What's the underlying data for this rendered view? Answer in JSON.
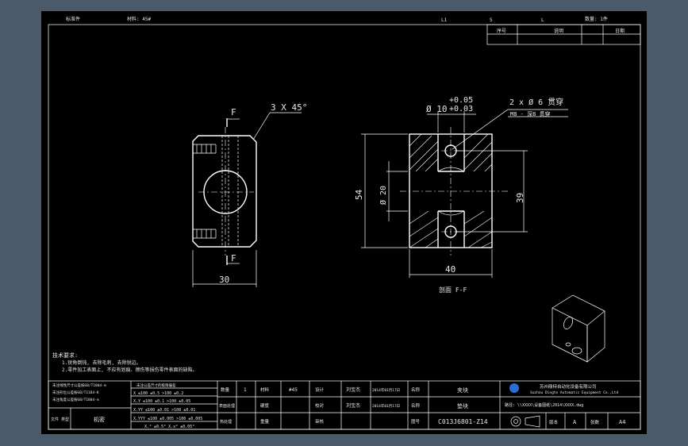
{
  "top_strip": {
    "left_1": "标准件",
    "left_2": "材料: 45#",
    "mark_l1": "L1",
    "mark_s": "S",
    "mark_l": "L",
    "mark_qty": "数量: 1件"
  },
  "rev_table": {
    "c1": "序号",
    "c2": "说明",
    "c3": "日期"
  },
  "front_view": {
    "label_f_top": "F",
    "label_f_bottom": "F",
    "chamfer": "3 X 45°",
    "width": "30"
  },
  "section_view": {
    "tol_upper": "+0.05",
    "tol_lower": "+0.03",
    "bore_dia": "Ø 10",
    "hole_note": "2 x Ø 6 贯穿",
    "hole_note2": "M8 - 深8 贯穿",
    "height": "54",
    "dia20": "Ø 20",
    "dim39": "39",
    "width": "40",
    "caption": "剖面 F-F"
  },
  "tech_notes": {
    "title": "技术要求:",
    "line1": "1.锐角倒钝, 去除毛刺, 去除锐边。",
    "line2": "2.零件加工表面上, 不应有划痕、擦伤等损伤零件表面的缺陷。"
  },
  "tolerance_table": {
    "head_left1": "未注线性尺寸公差按GB/T1804-m",
    "head_left2": "未注形位公差按GB/T1184-K",
    "head_left3": "未注角度公差按GB/T1804-m",
    "head_right": "未注公差尺寸的极限偏差",
    "rows": [
      "X      ≤100  ±0.5  >100  ±0.2",
      "X.Y    ≤100  ±0.1  >100  ±0.05",
      "X.YY   ≤100  ±0.01  >100  ±0.01",
      "X.YYY  ≤100  ±0.005  >100  ±0.005",
      "X.°  ±0.5°     X.x°  ±0.05°"
    ],
    "bottom_left": "机密",
    "bottom_left2": "文件\n类型"
  },
  "title_block": {
    "r1": [
      "数量",
      "1",
      "材料",
      "#45",
      "设计",
      "刘宝杰",
      "2014年01月17日",
      "名称",
      "夹块"
    ],
    "r2": [
      "表面处理",
      "",
      "硬度",
      "",
      "校对",
      "刘宝杰",
      "2014年01月17日",
      "名称",
      "垫块"
    ],
    "r3": [
      "热处理",
      "",
      "重量",
      "",
      "审核",
      "",
      "",
      "图号",
      "C013J6801-Z14"
    ],
    "company": "苏州鼎特自动化设备有限公司",
    "company_en": "Suzhou Dingte Automatic Equipment Co.,Ltd",
    "path": "路径: \\\\XXXX\\设备图纸\\2014\\XXXX.dwg",
    "scale_label": "版本",
    "scale_val": "A",
    "size_label": "张数",
    "size_val": "A4"
  }
}
